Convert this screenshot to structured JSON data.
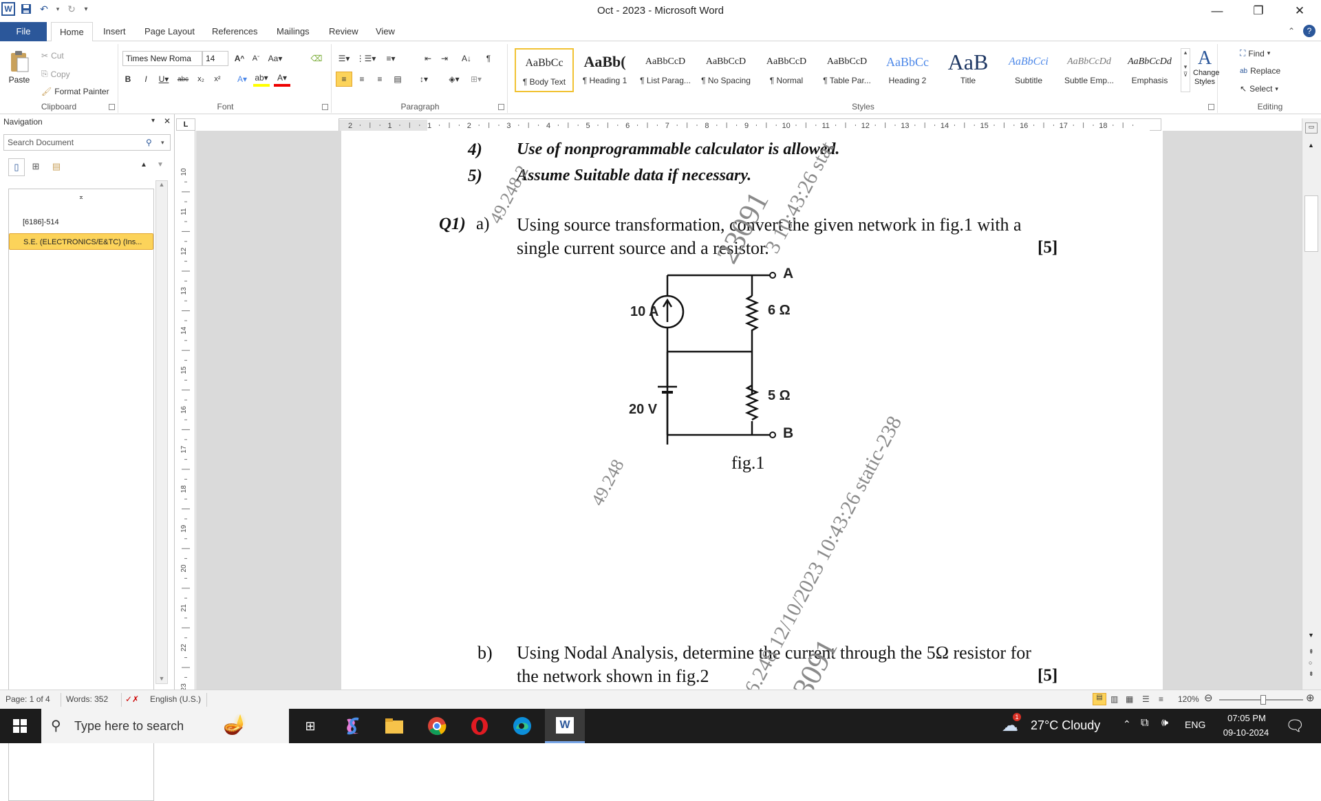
{
  "window": {
    "title": "Oct - 2023  -  Microsoft Word",
    "app_logo": "W",
    "colors": {
      "brand": "#2b579a",
      "nav_selected": "#fcd35a",
      "taskbar": "#1c1c1c"
    }
  },
  "tabs": [
    "File",
    "Home",
    "Insert",
    "Page Layout",
    "References",
    "Mailings",
    "Review",
    "View"
  ],
  "ribbon": {
    "clipboard": {
      "paste": "Paste",
      "cut": "Cut",
      "copy": "Copy",
      "format_painter": "Format Painter",
      "label": "Clipboard"
    },
    "font": {
      "family": "Times New Roma",
      "size": "14",
      "label": "Font"
    },
    "paragraph": {
      "label": "Paragraph"
    },
    "styles": {
      "label": "Styles",
      "items": [
        {
          "preview": "AaBbCc",
          "name": "¶ Body Text"
        },
        {
          "preview": "AaBb(",
          "name": "¶ Heading 1"
        },
        {
          "preview": "AaBbCcD",
          "name": "¶ List Parag..."
        },
        {
          "preview": "AaBbCcD",
          "name": "¶ No Spacing"
        },
        {
          "preview": "AaBbCcD",
          "name": "¶ Normal"
        },
        {
          "preview": "AaBbCcD",
          "name": "¶ Table Par..."
        },
        {
          "preview": "AaBbCc",
          "name": "Heading 2"
        },
        {
          "preview": "AaB",
          "name": "Title"
        },
        {
          "preview": "AaBbCci",
          "name": "Subtitle"
        },
        {
          "preview": "AaBbCcDd",
          "name": "Subtle Emp..."
        },
        {
          "preview": "AaBbCcDd",
          "name": "Emphasis"
        }
      ],
      "change_styles": "Change Styles"
    },
    "editing": {
      "find": "Find",
      "replace": "Replace",
      "select": "Select",
      "label": "Editing"
    }
  },
  "navigation": {
    "title": "Navigation",
    "search_placeholder": "Search Document",
    "entries": [
      "[6186]-514",
      "S.E. (ELECTRONICS/E&TC) (Ins..."
    ]
  },
  "ruler": {
    "labels": [
      "2",
      "1",
      "1",
      "2",
      "3",
      "4",
      "5",
      "6",
      "7",
      "8",
      "9",
      "10",
      "11",
      "12",
      "13",
      "14",
      "15",
      "16",
      "17",
      "18"
    ],
    "vlabels": [
      "10",
      "11",
      "12",
      "13",
      "14",
      "15",
      "16",
      "17",
      "18",
      "19",
      "20",
      "21",
      "22",
      "23"
    ]
  },
  "document": {
    "instr4_num": "4)",
    "instr4_text": "Use of nonprogrammable calculator is allowed.",
    "instr5_num": "5)",
    "instr5_text": "Assume Suitable data if necessary.",
    "q1_label": "Q1)",
    "q1a_label": "a)",
    "q1a_line1": "Using source transformation, convert the given network in fig.1 with a",
    "q1a_line2": "single current source and a resistor.",
    "q1a_marks": "[5]",
    "circuit": {
      "current_source": "10 A",
      "voltage_source": "20 V",
      "r1": "6 Ω",
      "r2": "5 Ω",
      "terminal_a": "A",
      "terminal_b": "B"
    },
    "fig_caption": "fig.1",
    "q1b_label": "b)",
    "q1b_line1": "Using Nodal Analysis, determine the current through the 5Ω resistor for",
    "q1b_line2": "the network shown in fig.2",
    "q1b_marks": "[5]",
    "watermarks": [
      "49.248.2",
      "23091",
      "3 10:43:26 stat",
      "49.248",
      "6.248 12/10/2023 10:43:26 static-238",
      "23091"
    ]
  },
  "status": {
    "page": "Page: 1 of 4",
    "words": "Words: 352",
    "language": "English (U.S.)",
    "zoom": "120%"
  },
  "taskbar": {
    "search_placeholder": "Type here to search",
    "weather": "27°C  Cloudy",
    "language": "ENG",
    "time": "07:05 PM",
    "date": "09-10-2024"
  }
}
